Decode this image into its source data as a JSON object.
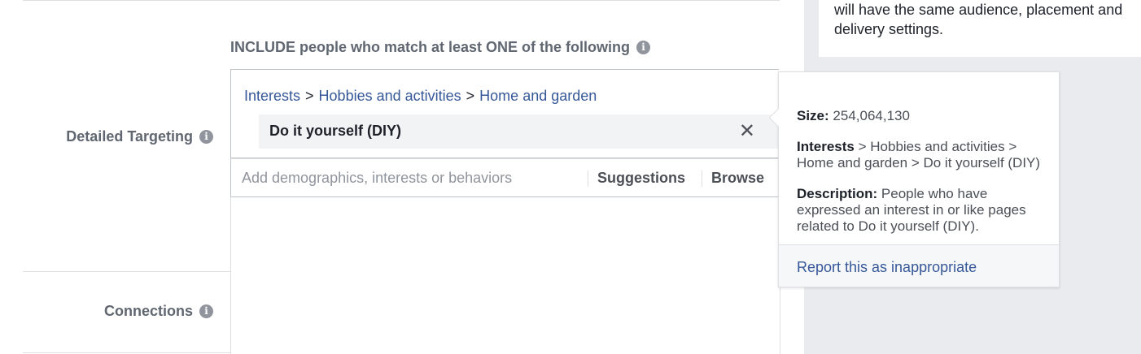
{
  "side_card": {
    "text": "will have the same audience, placement and delivery settings."
  },
  "include": {
    "heading": "INCLUDE people who match at least ONE of the following"
  },
  "labels": {
    "detailed_targeting": "Detailed Targeting",
    "connections": "Connections"
  },
  "targeting": {
    "breadcrumb": [
      "Interests",
      "Hobbies and activities",
      "Home and garden"
    ],
    "separator": ">",
    "selected_item": "Do it yourself (DIY)",
    "remove_symbol": "✕"
  },
  "search": {
    "placeholder": "Add demographics, interests or behaviors",
    "suggestions_label": "Suggestions",
    "browse_label": "Browse"
  },
  "tooltip": {
    "size_label": "Size:",
    "size_value": "254,064,130",
    "path_label": "Interests",
    "path_rest": "> Hobbies and activities > Home and garden > Do it yourself (DIY)",
    "description_label": "Description:",
    "description_text": "People who have expressed an interest in or like pages related to Do it yourself (DIY).",
    "report_label": "Report this as inappropriate"
  },
  "icons": {
    "info": "i"
  },
  "colors": {
    "link_blue": "#365899",
    "label_gray": "#606770",
    "panel_bg": "#e9ebee"
  }
}
